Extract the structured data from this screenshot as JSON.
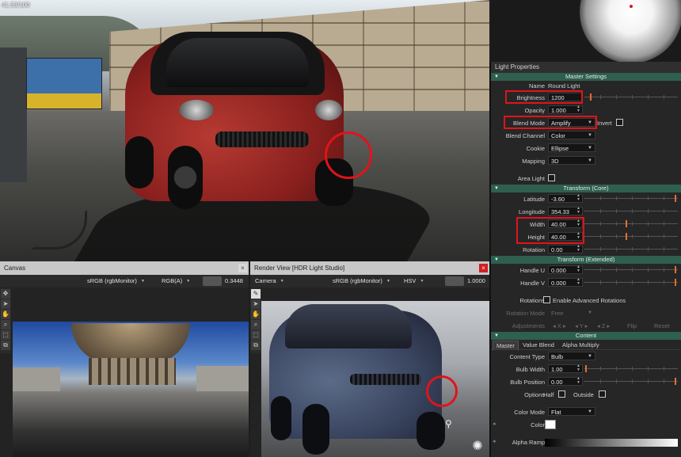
{
  "hero": {
    "counter": "41.53/100"
  },
  "properties": {
    "title": "Light Properties",
    "section_master": "Master Settings",
    "name_label": "Name",
    "name_value": "Round Light",
    "brightness_label": "Brightness",
    "brightness_value": "1200",
    "opacity_label": "Opacity",
    "opacity_value": "1.000",
    "blend_mode_label": "Blend Mode",
    "blend_mode_value": "Amplify",
    "invert_label": "Invert",
    "blend_channel_label": "Blend Channel",
    "blend_channel_value": "Color",
    "cookie_label": "Cookie",
    "cookie_value": "Ellipse",
    "mapping_label": "Mapping",
    "mapping_value": "3D",
    "area_light_label": "Area Light",
    "section_transform_core": "Transform (Core)",
    "latitude_label": "Latitude",
    "latitude_value": "-3.60",
    "longitude_label": "Longitude",
    "longitude_value": "354.33",
    "width_label": "Width",
    "width_value": "40.00",
    "height_label": "Height",
    "height_value": "40.00",
    "rotation_label": "Rotation",
    "rotation_value": "0.00",
    "section_transform_ext": "Transform (Extended)",
    "handle_u_label": "Handle U",
    "handle_u_value": "0.000",
    "handle_v_label": "Handle V",
    "handle_v_value": "0.000",
    "rotations_label": "Rotations",
    "adv_rotations_label": "Enable Advanced Rotations",
    "rotation_mode_label": "Rotation Mode",
    "rotation_mode_value": "Free",
    "adjustments_label": "Adjustments",
    "adj_x": "X",
    "adj_y": "Y",
    "adj_z": "Z",
    "flip_label": "Flip",
    "reset_label": "Reset",
    "section_content": "Content",
    "tab_master": "Master",
    "tab_value_blend": "Value Blend",
    "tab_alpha_multiply": "Alpha Multiply",
    "content_type_label": "Content Type",
    "content_type_value": "Bulb",
    "bulb_width_label": "Bulb Width",
    "bulb_width_value": "1.00",
    "bulb_position_label": "Bulb Position",
    "bulb_position_value": "0.00",
    "options_label": "Options",
    "half_label": "Half",
    "outside_label": "Outside",
    "color_mode_label": "Color Mode",
    "color_mode_value": "Flat",
    "color_label": "Color",
    "alpha_ramp_label": "Alpha Ramp",
    "slider_levels": {
      "brightness": 0.06,
      "latitude": 0.98,
      "width": 0.45,
      "height": 0.45,
      "handle_u": 0.98,
      "handle_v": 0.98,
      "bulb_width": 0.01,
      "bulb_position": 0.98
    }
  },
  "canvas": {
    "title": "Canvas",
    "colorspace": "sRGB (rgbMonitor)",
    "channel": "RGB(A)",
    "zoom_value": "0.3448"
  },
  "render": {
    "title": "Render View [HDR Light Studio]",
    "camera": "Camera",
    "colorspace": "sRGB (rgbMonitor)",
    "mode": "HSV",
    "zoom_value": "1.0000"
  },
  "colors": {
    "highlight": "#e0141a",
    "section": "#2e5f4f",
    "knob": "#e07030"
  }
}
